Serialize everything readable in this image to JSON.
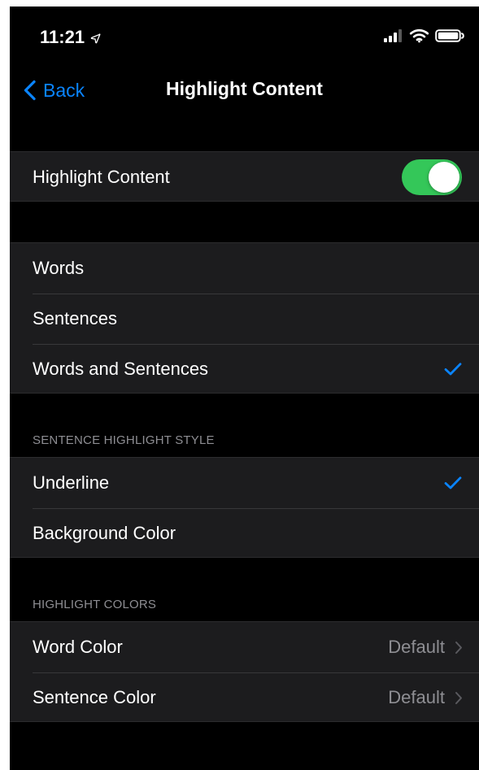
{
  "colors": {
    "background": "#000000",
    "cell_background": "#1c1c1e",
    "text": "#ffffff",
    "secondary_text": "#8e8e93",
    "accent": "#0a84ff",
    "toggle_on": "#34c759"
  },
  "status_bar": {
    "time": "11:21",
    "icons": [
      "location-arrow-icon",
      "cellular-signal-icon",
      "wifi-icon",
      "battery-icon"
    ]
  },
  "nav": {
    "back_label": "Back",
    "title": "Highlight Content"
  },
  "toggle_section": {
    "label": "Highlight Content",
    "enabled": true
  },
  "highlight_mode": {
    "options": [
      {
        "label": "Words",
        "selected": false
      },
      {
        "label": "Sentences",
        "selected": false
      },
      {
        "label": "Words and Sentences",
        "selected": true
      }
    ]
  },
  "sentence_highlight_style": {
    "header": "SENTENCE HIGHLIGHT STYLE",
    "options": [
      {
        "label": "Underline",
        "selected": true
      },
      {
        "label": "Background Color",
        "selected": false
      }
    ]
  },
  "highlight_colors": {
    "header": "HIGHLIGHT COLORS",
    "items": [
      {
        "label": "Word Color",
        "value": "Default"
      },
      {
        "label": "Sentence Color",
        "value": "Default"
      }
    ]
  }
}
